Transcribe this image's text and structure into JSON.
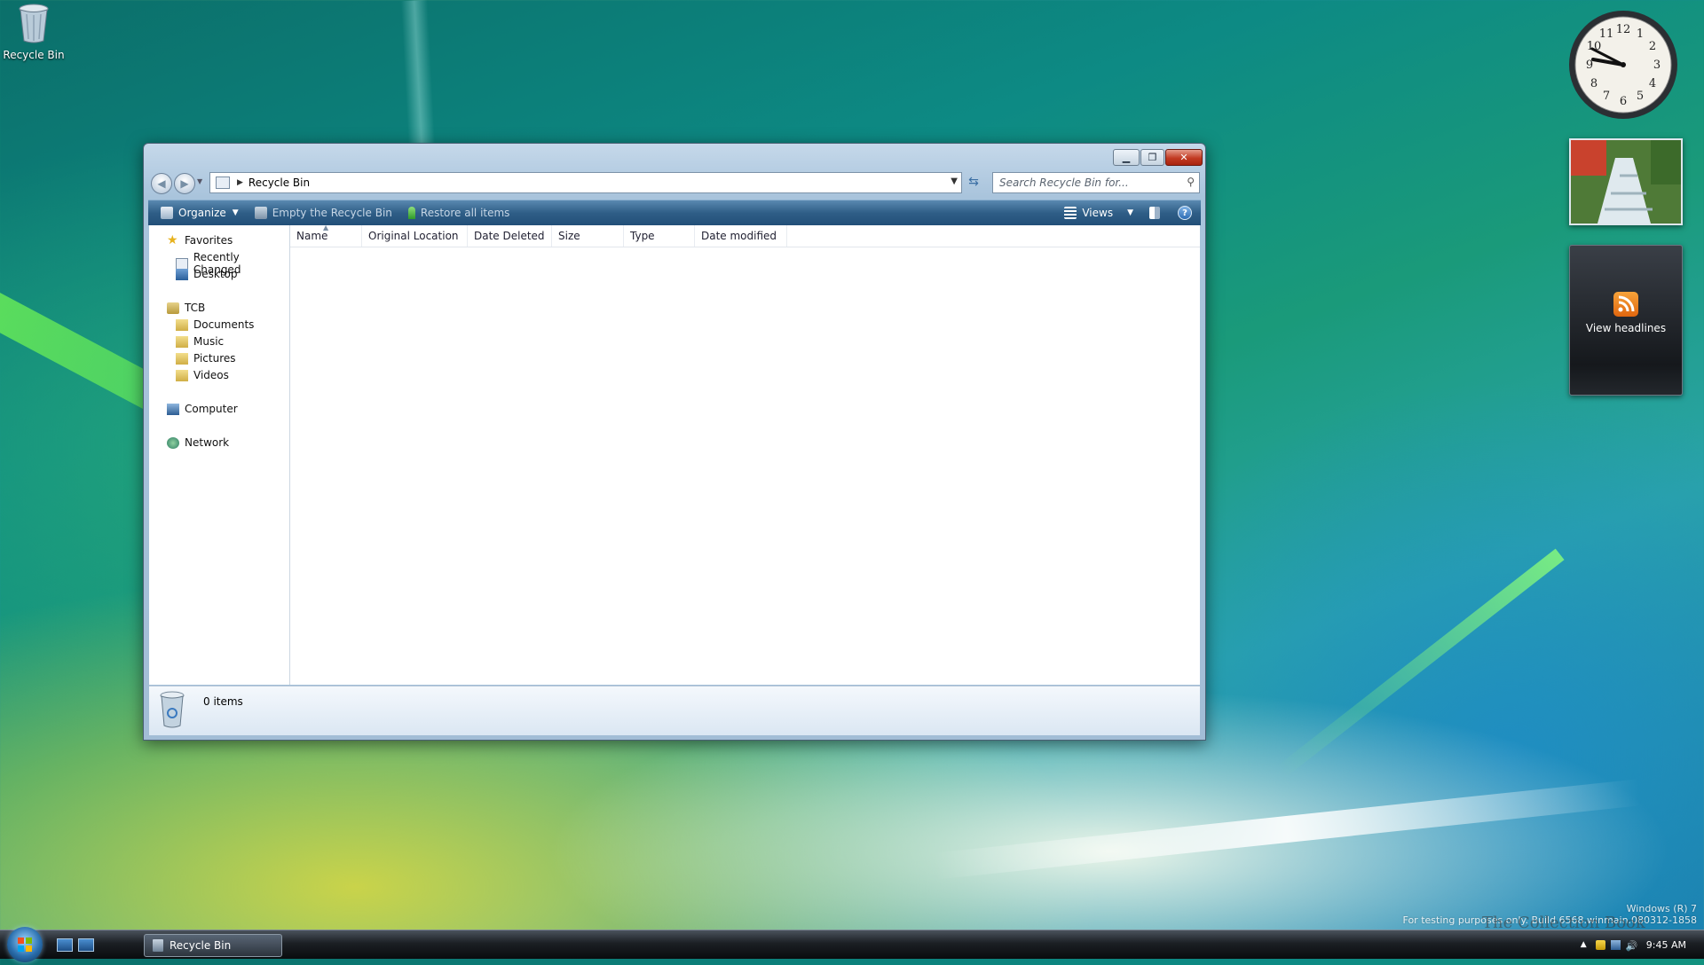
{
  "desktop": {
    "recycle_bin_label": "Recycle Bin"
  },
  "gadgets": {
    "feed_label": "View headlines"
  },
  "window": {
    "address_path": "Recycle Bin",
    "search_placeholder": "Search Recycle Bin for...",
    "toolbar": {
      "organize": "Organize",
      "empty": "Empty the Recycle Bin",
      "restore": "Restore all items",
      "views": "Views"
    },
    "nav": {
      "favorites": "Favorites",
      "recently_changed": "Recently Changed",
      "desktop": "Desktop",
      "user": "TCB",
      "documents": "Documents",
      "music": "Music",
      "pictures": "Pictures",
      "videos": "Videos",
      "computer": "Computer",
      "network": "Network"
    },
    "columns": [
      "Name",
      "Original Location",
      "Date Deleted",
      "Size",
      "Type",
      "Date modified"
    ],
    "status_count": "0 items"
  },
  "taskbar": {
    "task_label": "Recycle Bin",
    "time": "9:45 AM"
  },
  "watermark": {
    "line1": "Windows (R) 7",
    "line2": "For testing purposes only. Build 6568.winmain.080312-1858",
    "overlay": "The Collection Book"
  },
  "colors": {
    "toolbar_bg": "#2f5e87",
    "close_red": "#c23a22",
    "rss_orange": "#f07b1e"
  }
}
